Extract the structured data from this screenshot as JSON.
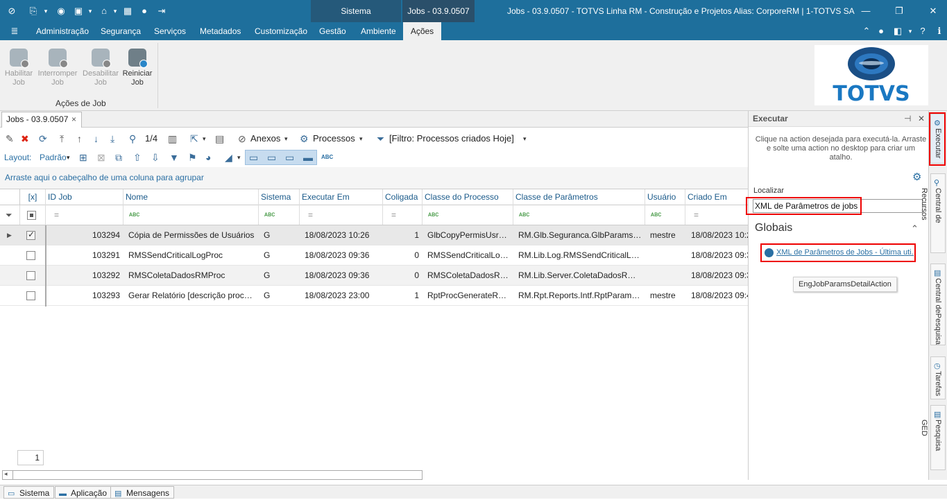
{
  "titlebar": {
    "tab_sistema": "Sistema",
    "tab_jobs": "Jobs - 03.9.0507",
    "title": "Jobs - 03.9.0507 - TOTVS Linha RM - Construção e Projetos  Alias: CorporeRM | 1-TOTVS SA",
    "icons": [
      "app-logo-icon",
      "bookmarks-icon",
      "view-icon",
      "screen-icon",
      "home-icon",
      "grid-icon",
      "globe-icon",
      "exit-icon"
    ]
  },
  "menu": {
    "items": [
      "Administração",
      "Segurança",
      "Serviços",
      "Metadados",
      "Customização",
      "Gestão",
      "Ambiente",
      "Ações"
    ],
    "active": "Ações"
  },
  "ribbon": {
    "buttons": [
      {
        "label1": "Habilitar",
        "label2": "Job",
        "enabled": false
      },
      {
        "label1": "Interromper",
        "label2": "Job",
        "enabled": false
      },
      {
        "label1": "Desabilitar",
        "label2": "Job",
        "enabled": false
      },
      {
        "label1": "Reiniciar",
        "label2": "Job",
        "enabled": true
      }
    ],
    "group_label": "Ações de Job"
  },
  "logo": {
    "text": "TOTVS"
  },
  "doc_tab": {
    "label": "Jobs - 03.9.0507",
    "close": "×"
  },
  "toolbar": {
    "page": "1/4",
    "anexos": "Anexos",
    "processos": "Processos",
    "filtro": "[Filtro: Processos criados Hoje]",
    "layout_label": "Layout:",
    "layout_value": "Padrão",
    "abc": "ABC"
  },
  "groupbar": {
    "text": "Arraste aqui o cabeçalho de uma coluna para agrupar"
  },
  "grid": {
    "columns": [
      "[x]",
      "ID Job",
      "Nome",
      "Sistema",
      "Executar Em",
      "Coligada",
      "Classe do Processo",
      "Classe de Parâmetros",
      "Usuário",
      "Criado Em"
    ],
    "filter_eq": "=",
    "filter_abc": "ᴀʙc",
    "rows": [
      {
        "checked": true,
        "id": "103294",
        "nome": "Cópia de Permissões de Usuários",
        "sistema": "G",
        "executar": "18/08/2023 10:26",
        "coligada": "1",
        "classe": "GlbCopyPermisUsrProc",
        "params": "RM.Glb.Seguranca.GlbParamsProc...",
        "usuario": "mestre",
        "criado": "18/08/2023 10:2"
      },
      {
        "checked": false,
        "id": "103291",
        "nome": "RMSSendCriticalLogProc",
        "sistema": "G",
        "executar": "18/08/2023 09:36",
        "coligada": "0",
        "classe": "RMSSendCriticalLogProc",
        "params": "RM.Lib.Log.RMSSendCriticalLogPar...",
        "usuario": "",
        "criado": "18/08/2023 09:3"
      },
      {
        "checked": false,
        "id": "103292",
        "nome": "RMSColetaDadosRMProc",
        "sistema": "G",
        "executar": "18/08/2023 09:36",
        "coligada": "0",
        "classe": "RMSColetaDadosRMPr...",
        "params": "RM.Lib.Server.ColetaDadosRM.RM...",
        "usuario": "",
        "criado": "18/08/2023 09:3"
      },
      {
        "checked": false,
        "id": "103293",
        "nome": "Gerar Relatório [descrição processo...",
        "sistema": "G",
        "executar": "18/08/2023 23:00",
        "coligada": "1",
        "classe": "RptProcGenerateReport",
        "params": "RM.Rpt.Reports.Intf.RptParamsPr...",
        "usuario": "mestre",
        "criado": "18/08/2023 09:4"
      }
    ],
    "page_value": "1"
  },
  "panel": {
    "title": "Executar",
    "pin": "⊣",
    "close": "✕",
    "hint": "Clique na action desejada para executá-la. Arraste e solte uma action no desktop para criar um atalho.",
    "search_label": "Localizar",
    "search_value": "XML de Parâmetros de jobs",
    "section": "Globais",
    "result": "XML de Parâmetros de Jobs - Última uti...",
    "tooltip": "EngJobParamsDetailAction"
  },
  "rail": {
    "tabs": [
      "Executar",
      "Central de Recursos",
      "Central dePesquisa",
      "Tarefas",
      "Pesquisa GED"
    ]
  },
  "statusbar": {
    "items": [
      "Sistema",
      "Aplicação",
      "Mensagens"
    ]
  },
  "colors": {
    "brand": "#1e6f9c",
    "highlight": "#e00000",
    "link": "#2a6fa3"
  }
}
